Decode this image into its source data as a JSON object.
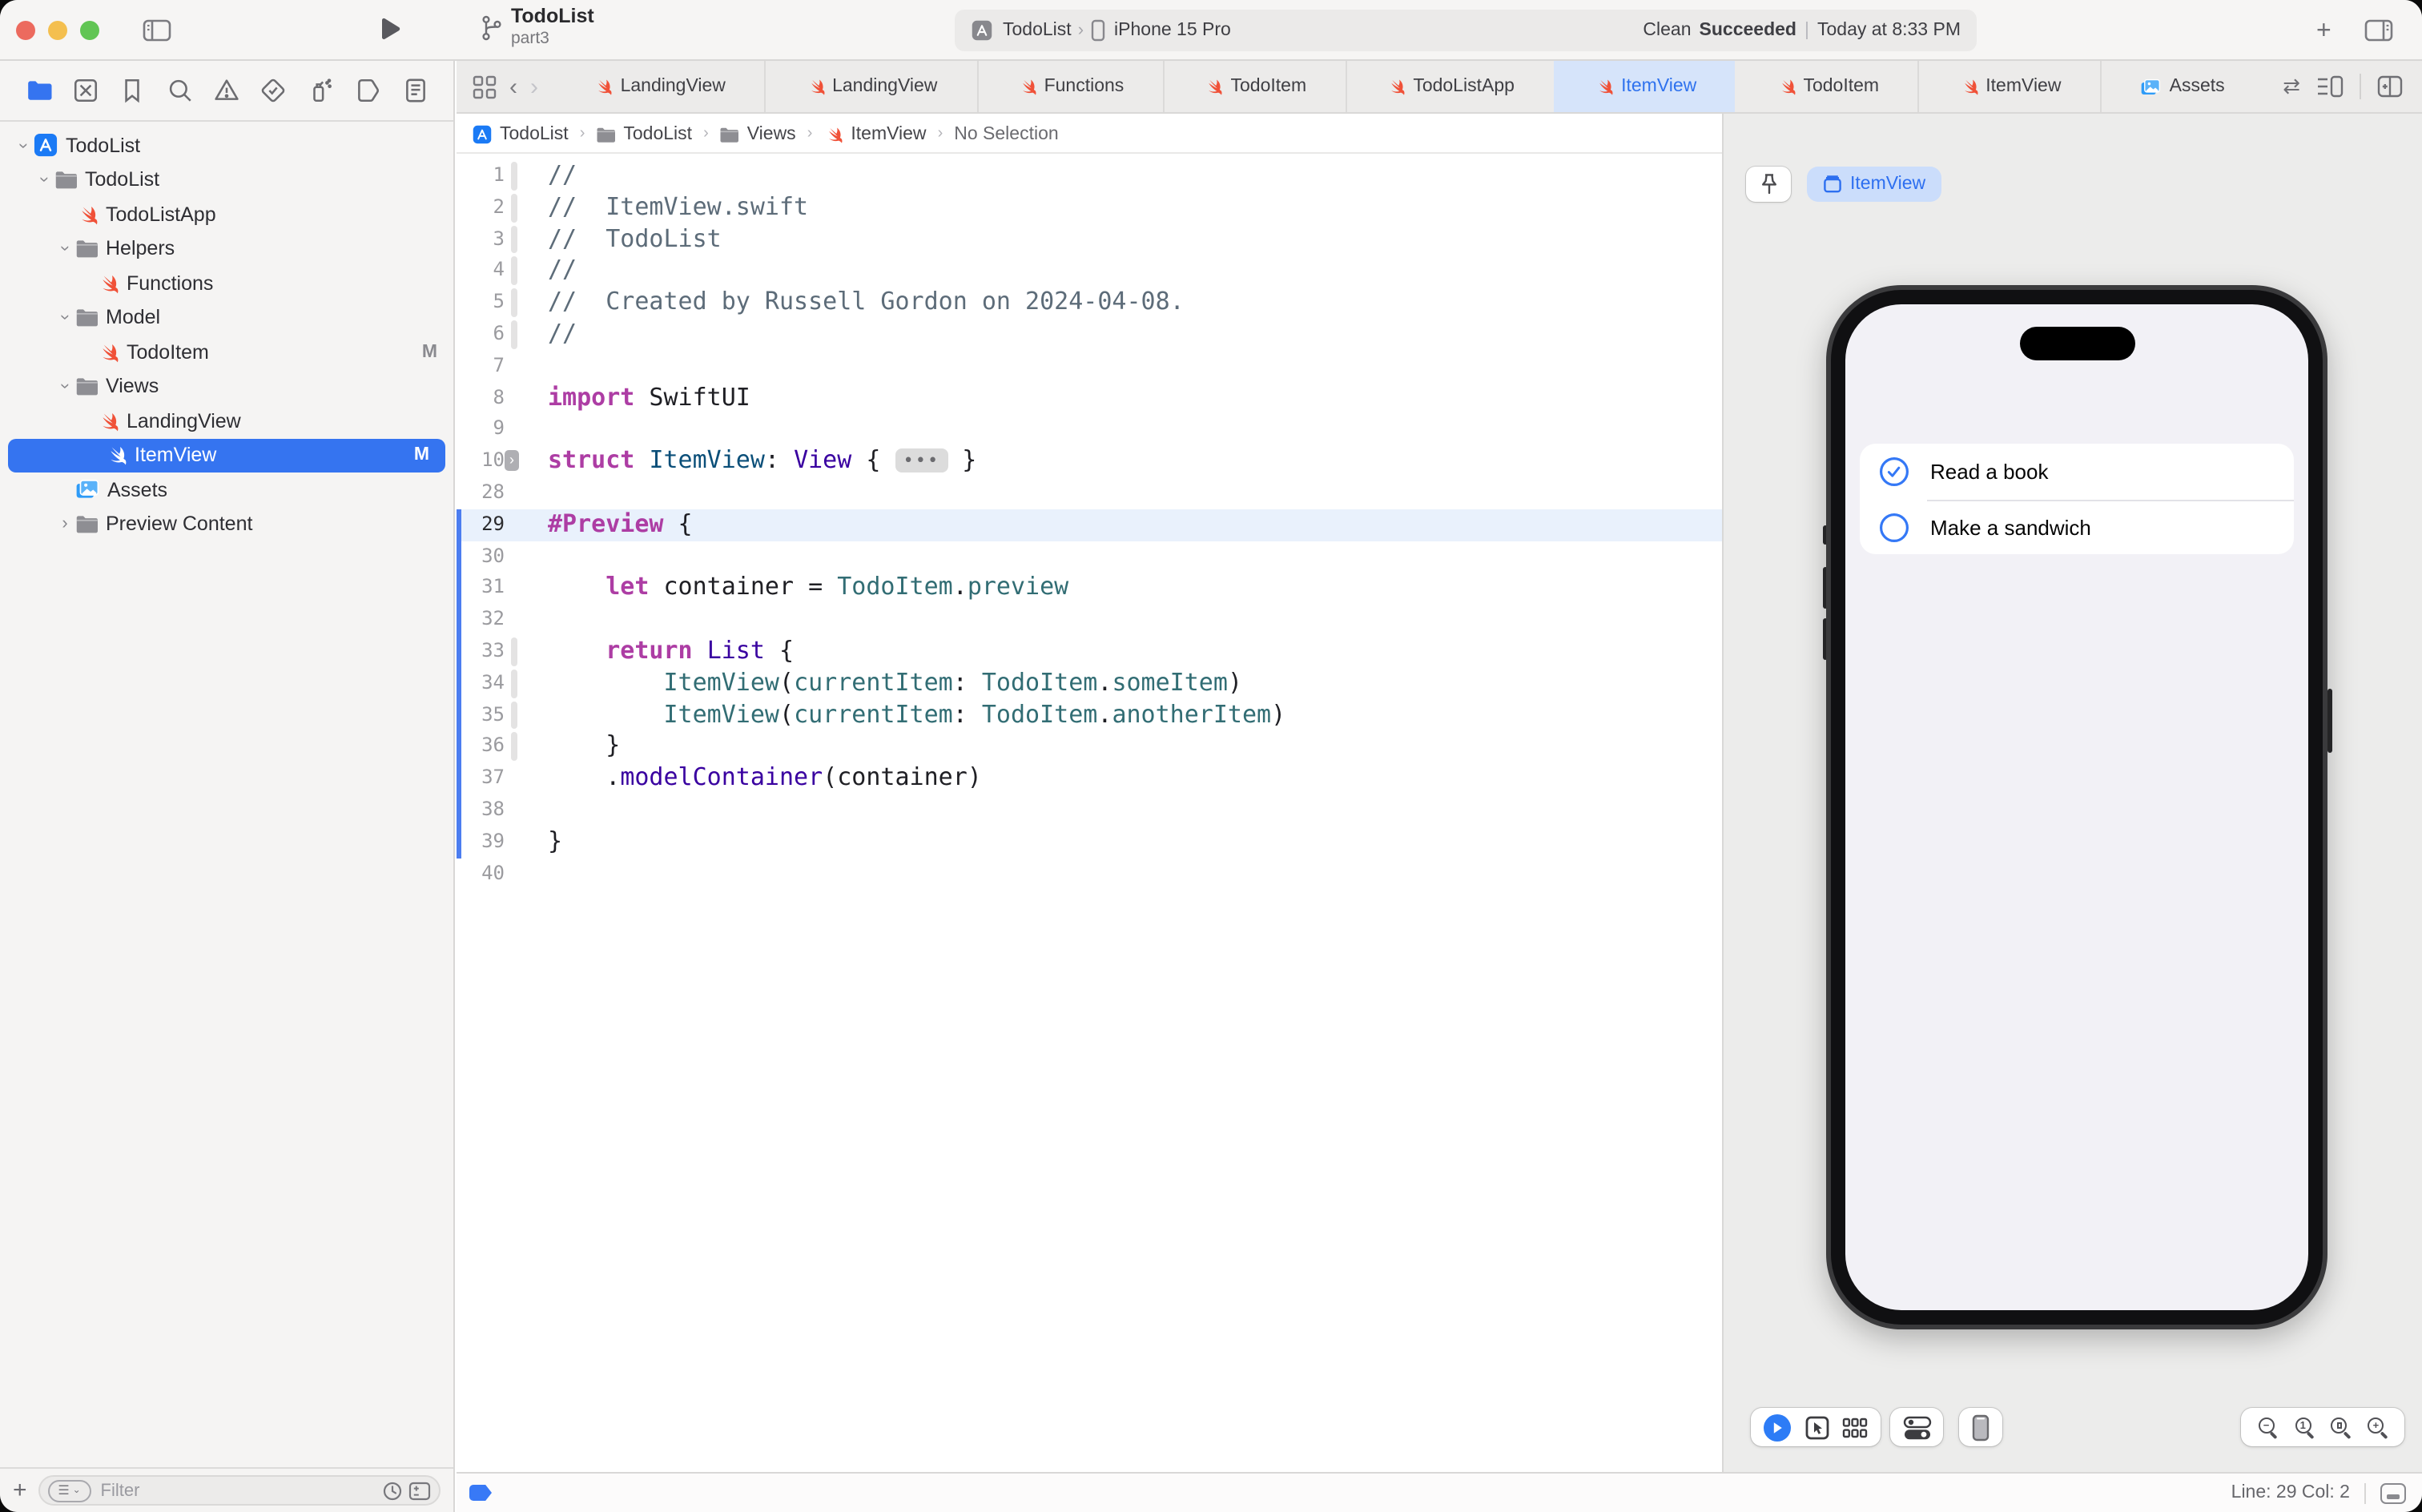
{
  "titlebar": {
    "title": "TodoList",
    "subtitle": "part3",
    "scheme": {
      "project": "TodoList",
      "chevron": "›",
      "device": "iPhone 15 Pro"
    },
    "status": {
      "action": "Clean",
      "result": "Succeeded",
      "divider": "|",
      "time": "Today at 8:33 PM"
    }
  },
  "navigator_tabs": [
    {
      "name": "project-navigator",
      "selected": true
    },
    {
      "name": "source-control-navigator",
      "selected": false
    },
    {
      "name": "bookmarks-navigator",
      "selected": false
    },
    {
      "name": "find-navigator",
      "selected": false
    },
    {
      "name": "issues-navigator",
      "selected": false
    },
    {
      "name": "tests-navigator",
      "selected": false
    },
    {
      "name": "debug-navigator",
      "selected": false
    },
    {
      "name": "breakpoints-navigator",
      "selected": false
    },
    {
      "name": "reports-navigator",
      "selected": false
    }
  ],
  "sidebar": {
    "items": [
      {
        "label": "TodoList",
        "icon": "app",
        "depth": 0,
        "disclosure": "open"
      },
      {
        "label": "TodoList",
        "icon": "folder",
        "depth": 1,
        "disclosure": "open"
      },
      {
        "label": "TodoListApp",
        "icon": "swift",
        "depth": 2
      },
      {
        "label": "Helpers",
        "icon": "folder",
        "depth": 2,
        "disclosure": "open"
      },
      {
        "label": "Functions",
        "icon": "swift",
        "depth": 3
      },
      {
        "label": "Model",
        "icon": "folder",
        "depth": 2,
        "disclosure": "open"
      },
      {
        "label": "TodoItem",
        "icon": "swift",
        "depth": 3,
        "badge": "M"
      },
      {
        "label": "Views",
        "icon": "folder",
        "depth": 2,
        "disclosure": "open"
      },
      {
        "label": "LandingView",
        "icon": "swift",
        "depth": 3
      },
      {
        "label": "ItemView",
        "icon": "swift",
        "depth": 3,
        "badge": "M",
        "selected": true
      },
      {
        "label": "Assets",
        "icon": "assets",
        "depth": 2
      },
      {
        "label": "Preview Content",
        "icon": "folder",
        "depth": 2,
        "disclosure": "closed"
      }
    ],
    "filter_placeholder": "Filter"
  },
  "tabs": [
    {
      "label": "LandingView",
      "icon": "swift"
    },
    {
      "label": "LandingView",
      "icon": "swift"
    },
    {
      "label": "Functions",
      "icon": "swift"
    },
    {
      "label": "TodoItem",
      "icon": "swift"
    },
    {
      "label": "TodoListApp",
      "icon": "swift"
    },
    {
      "label": "ItemView",
      "icon": "swift",
      "active": true
    },
    {
      "label": "TodoItem",
      "icon": "swift"
    },
    {
      "label": "ItemView",
      "icon": "swift"
    },
    {
      "label": "Assets",
      "icon": "assets"
    }
  ],
  "jumpbar": [
    {
      "label": "TodoList",
      "icon": "app"
    },
    {
      "label": "TodoList",
      "icon": "folder"
    },
    {
      "label": "Views",
      "icon": "folder"
    },
    {
      "label": "ItemView",
      "icon": "swift"
    },
    {
      "label": "No Selection",
      "icon": null,
      "dim": true
    }
  ],
  "editor": {
    "lines": [
      {
        "n": 1,
        "rib": true,
        "tokens": [
          [
            "c",
            "//"
          ]
        ]
      },
      {
        "n": 2,
        "rib": true,
        "tokens": [
          [
            "c",
            "//  ItemView.swift"
          ]
        ]
      },
      {
        "n": 3,
        "rib": true,
        "tokens": [
          [
            "c",
            "//  TodoList"
          ]
        ]
      },
      {
        "n": 4,
        "rib": true,
        "tokens": [
          [
            "c",
            "//"
          ]
        ]
      },
      {
        "n": 5,
        "rib": true,
        "tokens": [
          [
            "c",
            "//  Created by Russell Gordon on 2024-04-08."
          ]
        ]
      },
      {
        "n": 6,
        "rib": true,
        "tokens": [
          [
            "c",
            "//"
          ]
        ]
      },
      {
        "n": 7,
        "tokens": []
      },
      {
        "n": 8,
        "tokens": [
          [
            "k",
            "import"
          ],
          [
            "x",
            " SwiftUI"
          ]
        ]
      },
      {
        "n": 9,
        "tokens": []
      },
      {
        "n": 10,
        "fold": "›",
        "tokens": [
          [
            "k",
            "struct"
          ],
          [
            "x",
            " "
          ],
          [
            "d",
            "ItemView"
          ],
          [
            "x",
            ": "
          ],
          [
            "t",
            "View"
          ],
          [
            "x",
            " { "
          ],
          [
            "e",
            "•••"
          ],
          [
            "x",
            " }"
          ]
        ]
      },
      {
        "n": 28,
        "tokens": []
      },
      {
        "n": 29,
        "hl": true,
        "chg": true,
        "tokens": [
          [
            "k",
            "#Preview"
          ],
          [
            "x",
            " {"
          ]
        ]
      },
      {
        "n": 30,
        "chg": true,
        "tokens": []
      },
      {
        "n": 31,
        "chg": true,
        "tokens": [
          [
            "x",
            "    "
          ],
          [
            "k",
            "let"
          ],
          [
            "x",
            " container = "
          ],
          [
            "p",
            "TodoItem"
          ],
          [
            "x",
            "."
          ],
          [
            "p",
            "preview"
          ]
        ]
      },
      {
        "n": 32,
        "chg": true,
        "tokens": []
      },
      {
        "n": 33,
        "chg": true,
        "rib": true,
        "tokens": [
          [
            "x",
            "    "
          ],
          [
            "k",
            "return"
          ],
          [
            "x",
            " "
          ],
          [
            "t",
            "List"
          ],
          [
            "x",
            " {"
          ]
        ]
      },
      {
        "n": 34,
        "chg": true,
        "rib": true,
        "tokens": [
          [
            "x",
            "        "
          ],
          [
            "p",
            "ItemView"
          ],
          [
            "x",
            "("
          ],
          [
            "p",
            "currentItem"
          ],
          [
            "x",
            ": "
          ],
          [
            "p",
            "TodoItem"
          ],
          [
            "x",
            "."
          ],
          [
            "p",
            "someItem"
          ],
          [
            "x",
            ")"
          ]
        ]
      },
      {
        "n": 35,
        "chg": true,
        "rib": true,
        "tokens": [
          [
            "x",
            "        "
          ],
          [
            "p",
            "ItemView"
          ],
          [
            "x",
            "("
          ],
          [
            "p",
            "currentItem"
          ],
          [
            "x",
            ": "
          ],
          [
            "p",
            "TodoItem"
          ],
          [
            "x",
            "."
          ],
          [
            "p",
            "anotherItem"
          ],
          [
            "x",
            ")"
          ]
        ]
      },
      {
        "n": 36,
        "chg": true,
        "rib": true,
        "tokens": [
          [
            "x",
            "    }"
          ]
        ]
      },
      {
        "n": 37,
        "chg": true,
        "tokens": [
          [
            "x",
            "    ."
          ],
          [
            "t",
            "modelContainer"
          ],
          [
            "x",
            "(container)"
          ]
        ]
      },
      {
        "n": 38,
        "chg": true,
        "tokens": []
      },
      {
        "n": 39,
        "chg": true,
        "tokens": [
          [
            "x",
            "}"
          ]
        ]
      },
      {
        "n": 40,
        "tokens": []
      }
    ]
  },
  "canvas": {
    "chip_label": "ItemView",
    "todo_items": [
      {
        "label": "Read a book",
        "checked": true
      },
      {
        "label": "Make a sandwich",
        "checked": false
      }
    ]
  },
  "statusbar": {
    "line_col": "Line: 29  Col: 2"
  },
  "colors": {
    "accent_blue": "#3574F0",
    "tab_active_bg": "#D6E4FA",
    "swift_orange": "#F05138",
    "keyword": "#AD3DA4",
    "type_purple": "#3900A0",
    "project_teal": "#326D74",
    "comment": "#5D6C79",
    "change_bar": "#4C7DF0"
  }
}
